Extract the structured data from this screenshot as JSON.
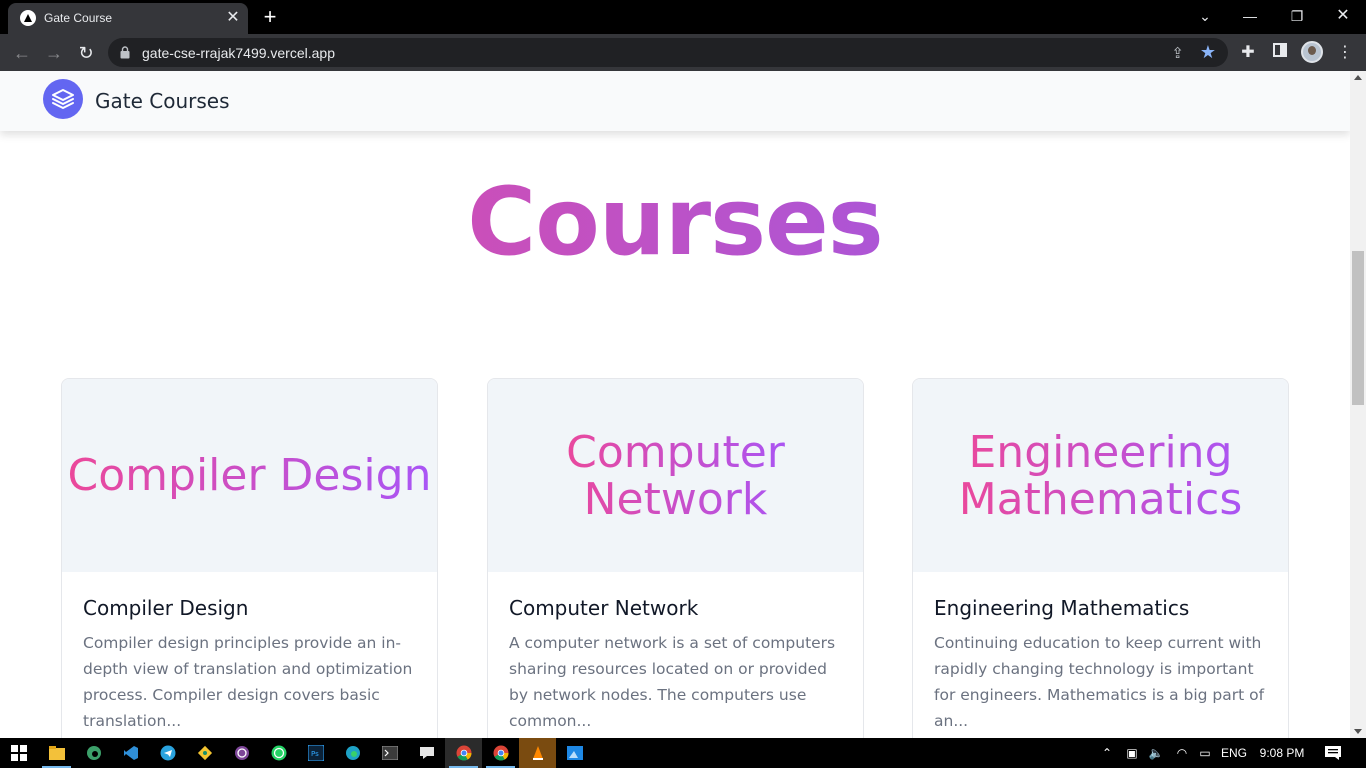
{
  "browser": {
    "tab_title": "Gate Course",
    "tab_close": "✕",
    "new_tab": "+",
    "url": "gate-cse-rrajak7499.vercel.app",
    "window_controls": {
      "minimize": "—",
      "restore": "❐",
      "close": "✕",
      "tab_search": "⌄"
    }
  },
  "site": {
    "brand": "Gate Courses",
    "hero_title": "Courses",
    "courses": [
      {
        "banner": "Compiler Design",
        "title": "Compiler Design",
        "description": "Compiler design principles provide an in-depth view of translation and optimization process. Compiler design covers basic translation..."
      },
      {
        "banner": "Computer Network",
        "title": "Computer Network",
        "description": "A computer network is a set of computers sharing resources located on or provided by network nodes. The computers use common..."
      },
      {
        "banner": "Engineering Mathematics",
        "title": "Engineering Mathematics",
        "description": "Continuing education to keep current with rapidly changing technology is important for engineers. Mathematics is a big part of an..."
      }
    ]
  },
  "taskbar": {
    "language": "ENG",
    "time": "9:08 PM",
    "apps": [
      "start-icon",
      "file-explorer-icon",
      "edge-dev-icon",
      "vscode-icon",
      "telegram-icon",
      "git-kraken-icon",
      "tor-icon",
      "whatsapp-icon",
      "photoshop-icon",
      "edge-icon",
      "terminal-icon",
      "chat-icon",
      "chrome-icon",
      "chrome-profile-icon",
      "vlc-icon",
      "photos-icon"
    ]
  },
  "colors": {
    "gradient_start": "#ec4899",
    "gradient_end": "#8b5cf6",
    "logo": "#6366f1"
  }
}
